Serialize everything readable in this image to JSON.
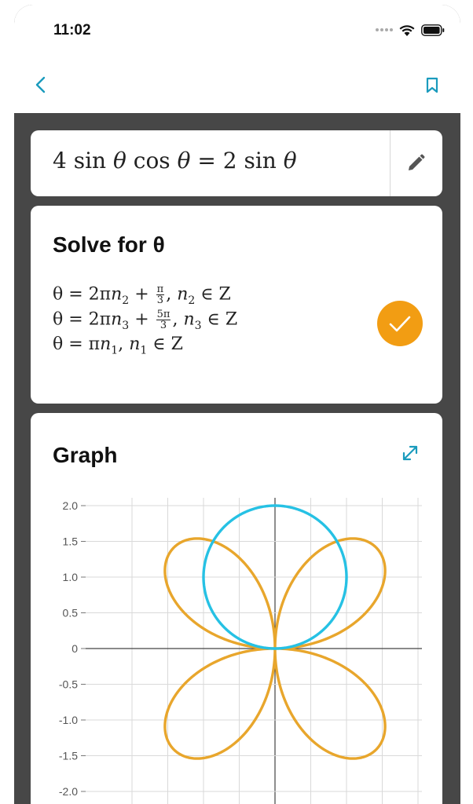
{
  "status": {
    "time": "11:02"
  },
  "colors": {
    "accent": "#1a9bbd",
    "orange": "#f29d13",
    "cyan": "#26c1e4",
    "background": "#474747"
  },
  "icons": {
    "back": "chevron-left-icon",
    "bookmark": "bookmark-icon",
    "edit": "pencil-icon",
    "check": "check-icon",
    "expand": "expand-icon"
  },
  "input": {
    "equation_parts": [
      "4",
      "sin",
      "θ",
      "cos",
      "θ",
      "=",
      "2",
      "sin",
      "θ"
    ]
  },
  "solve": {
    "title": "Solve for θ",
    "solutions": [
      {
        "prefix": "θ = 2π",
        "var": "n",
        "sub": "2",
        "plus": " + ",
        "num": "π",
        "den": "3",
        "rest": ", ",
        "set_var": "n",
        "set_sub": "2",
        "set": " ∈ Z"
      },
      {
        "prefix": "θ = 2π",
        "var": "n",
        "sub": "3",
        "plus": " + ",
        "num": "5π",
        "den": "3",
        "rest": ", ",
        "set_var": "n",
        "set_sub": "3",
        "set": " ∈ Z"
      },
      {
        "prefix": "θ = π",
        "var": "n",
        "sub": "1",
        "plus": "",
        "num": "",
        "den": "",
        "rest": ", ",
        "set_var": "n",
        "set_sub": "1",
        "set": " ∈ Z"
      }
    ]
  },
  "graph": {
    "title": "Graph"
  },
  "chart_data": {
    "type": "line",
    "title": "",
    "xlabel": "",
    "ylabel": "",
    "xlim": [
      -2.2,
      2.05
    ],
    "ylim": [
      -2.1,
      2.1
    ],
    "y_ticks": [
      "2.0",
      "1.5",
      "1.0",
      "0.5",
      "0",
      "-0.5",
      "-1.0",
      "-1.5",
      "-2.0"
    ],
    "y_tick_values": [
      2.0,
      1.5,
      1.0,
      0.5,
      0,
      -0.5,
      -1.0,
      -1.5,
      -2.0
    ],
    "x_grid_values": [
      -2.0,
      -1.5,
      -1.0,
      -0.5,
      0,
      0.5,
      1.0,
      1.5,
      2.0
    ],
    "grid": true,
    "series": [
      {
        "equation": "r = 4 sin θ cos θ",
        "polar": true,
        "color": "#e8a62c"
      },
      {
        "equation": "r = 2 sin θ",
        "polar": true,
        "color": "#26c1e4"
      }
    ]
  }
}
